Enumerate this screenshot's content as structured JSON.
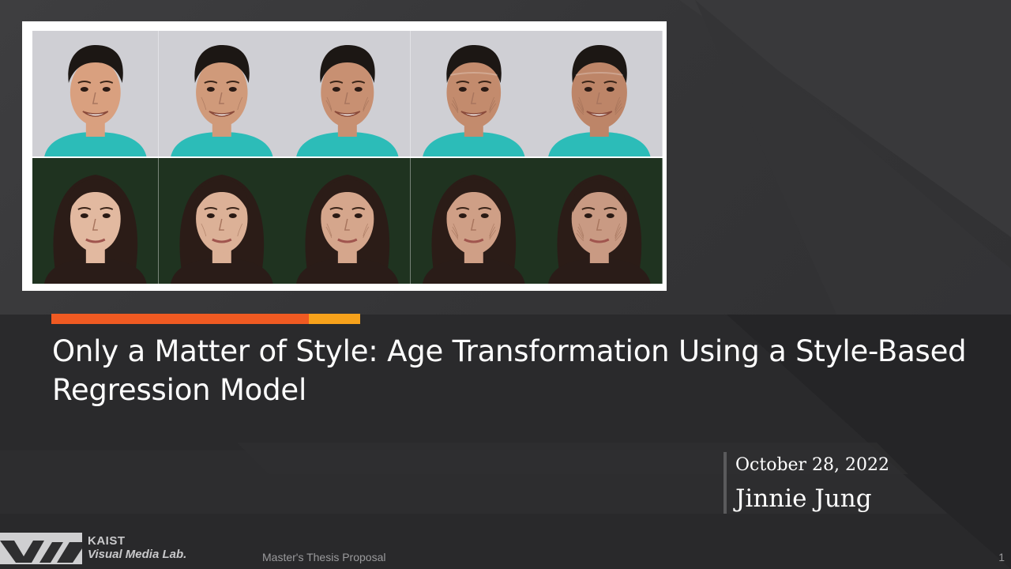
{
  "slide": {
    "title": "Only a Matter of Style: Age Transformation Using a Style-Based Regression Model",
    "date": "October 28, 2022",
    "author": "Jinnie Jung",
    "footer": {
      "org_line1": "KAIST",
      "org_line2": "Visual Media Lab.",
      "caption": "Master's Thesis Proposal",
      "page_number": "1"
    }
  },
  "figure": {
    "rows": [
      {
        "subject": "male",
        "background": "#cfcfd4",
        "shirt": "#2cbcb8",
        "hair": "#1c1714",
        "faces": [
          {
            "age_stage": "child",
            "skin": "#d9a07f"
          },
          {
            "age_stage": "young-adult",
            "skin": "#d09a7a"
          },
          {
            "age_stage": "adult",
            "skin": "#c89072"
          },
          {
            "age_stage": "middle-aged",
            "skin": "#c38b6d"
          },
          {
            "age_stage": "elderly",
            "skin": "#bd8568"
          }
        ]
      },
      {
        "subject": "female",
        "background": "#1f3320",
        "shirt": "#2a1c18",
        "hair": "#2b1c17",
        "faces": [
          {
            "age_stage": "child",
            "skin": "#e2b9a0"
          },
          {
            "age_stage": "young-adult",
            "skin": "#dcb197"
          },
          {
            "age_stage": "adult",
            "skin": "#d5a68c"
          },
          {
            "age_stage": "middle-aged",
            "skin": "#cf9f86"
          },
          {
            "age_stage": "elderly",
            "skin": "#c99a83"
          }
        ]
      }
    ]
  },
  "colors": {
    "accent_orange": "#f05a22",
    "accent_yellow": "#f7a21b"
  }
}
